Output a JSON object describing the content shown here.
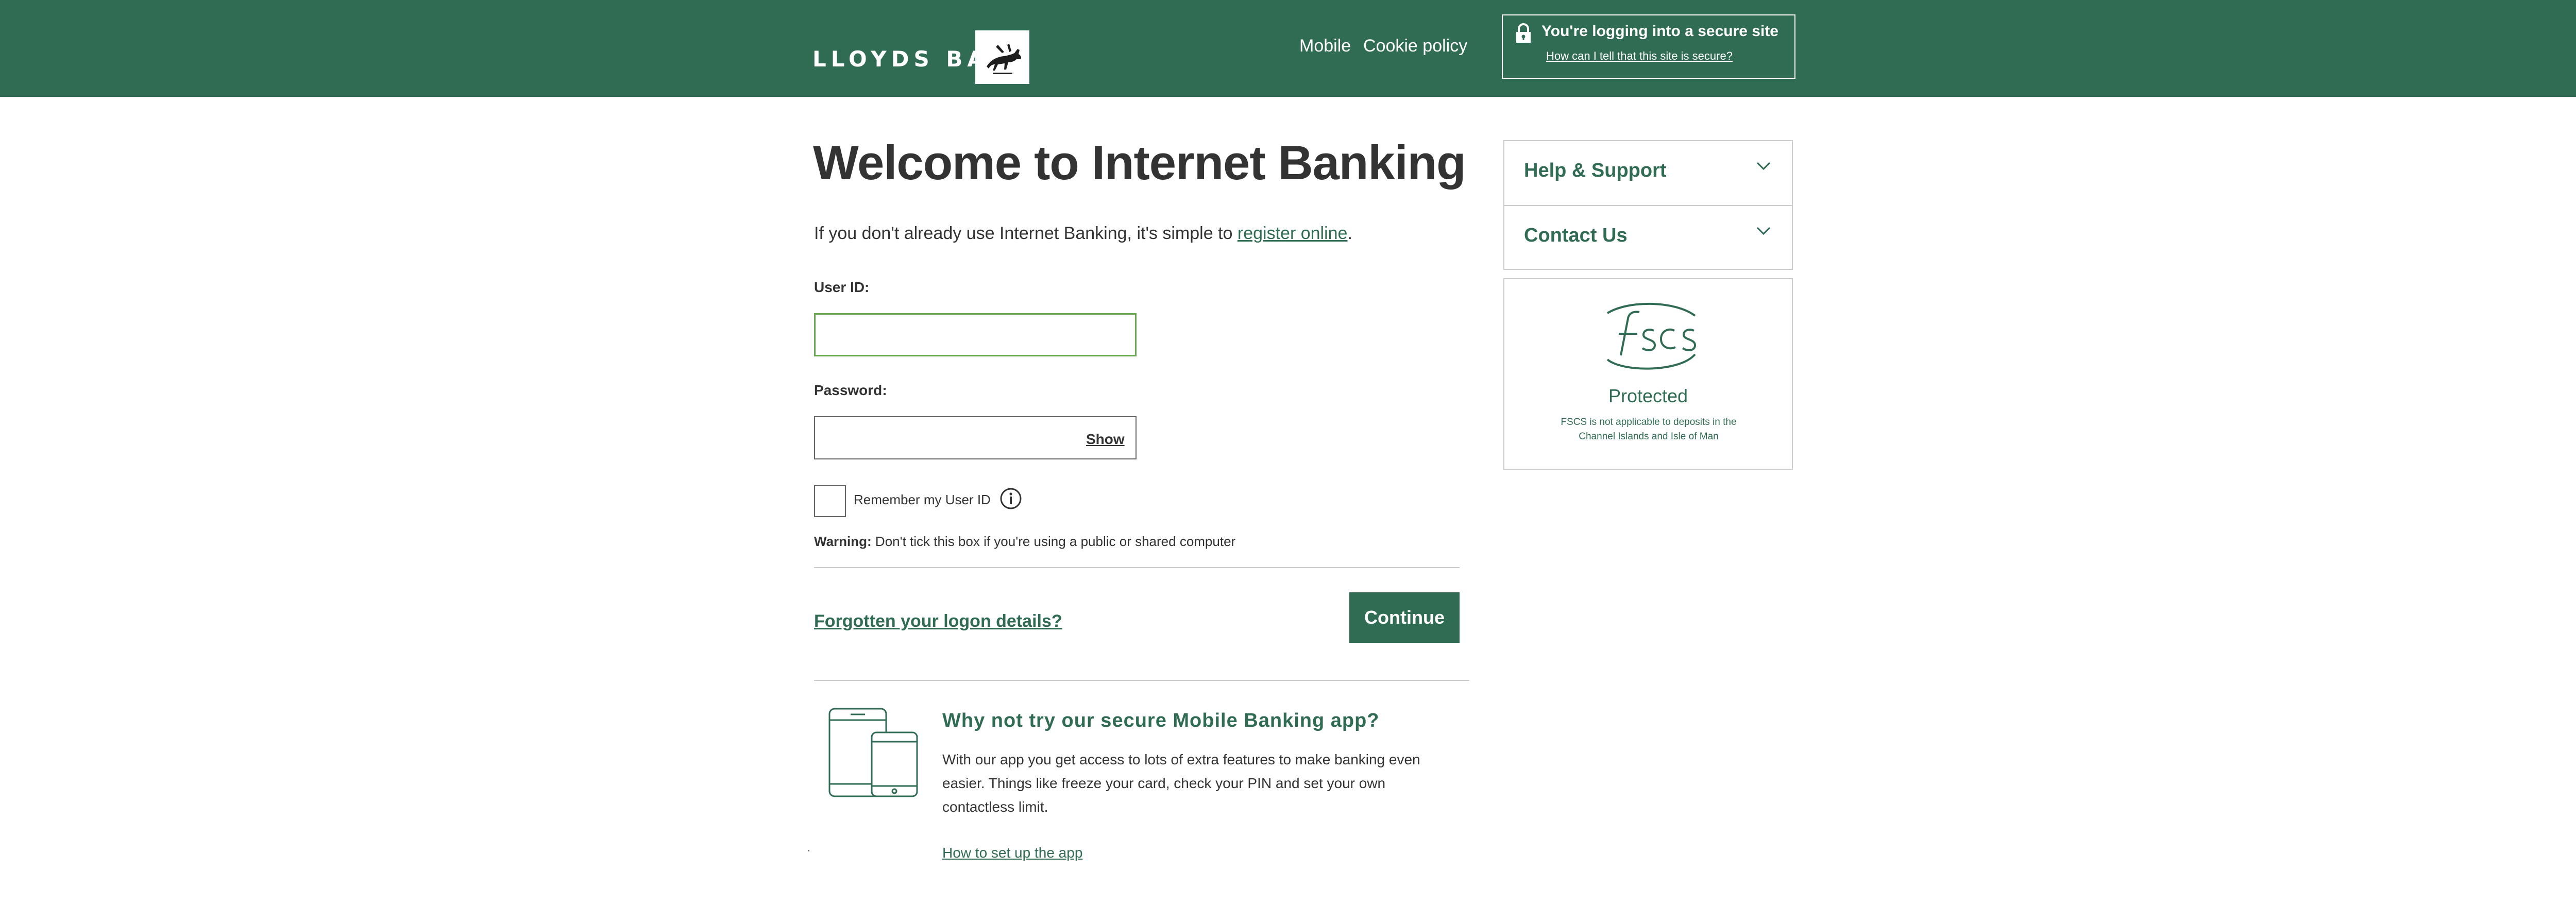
{
  "header": {
    "logo_text": "LLOYDS BANK",
    "nav": {
      "mobile": "Mobile",
      "cookie_policy": "Cookie policy"
    },
    "secure": {
      "title": "You're logging into a secure site",
      "link": "How can I tell that this site is secure?"
    },
    "brand_color": "#306c53"
  },
  "main": {
    "title": "Welcome to Internet Banking",
    "intro": {
      "prefix": "If you don't already use Internet Banking, it's simple to ",
      "link": "register online",
      "suffix": "."
    },
    "form": {
      "user_id_label": "User ID:",
      "password_label": "Password:",
      "show_label": "Show",
      "remember_label": "Remember my User ID",
      "warning_bold": "Warning:",
      "warning_text": "Don't tick this box if you're using a public or shared computer",
      "forgot_link": "Forgotten your logon details?",
      "continue_button": "Continue"
    },
    "app_promo": {
      "title": "Why not try our secure Mobile Banking app?",
      "text": "With our app you get access to lots of extra features to make banking even easier. Things like freeze your card, check your PIN and set your own contactless limit.",
      "link": "How to set up the app"
    }
  },
  "sidebar": {
    "accordion": [
      {
        "label": "Help & Support"
      },
      {
        "label": "Contact Us"
      }
    ],
    "fscs": {
      "logo_text": "fscs",
      "protected": "Protected",
      "note": "FSCS is not applicable to deposits in the Channel Islands and Isle of Man"
    }
  }
}
